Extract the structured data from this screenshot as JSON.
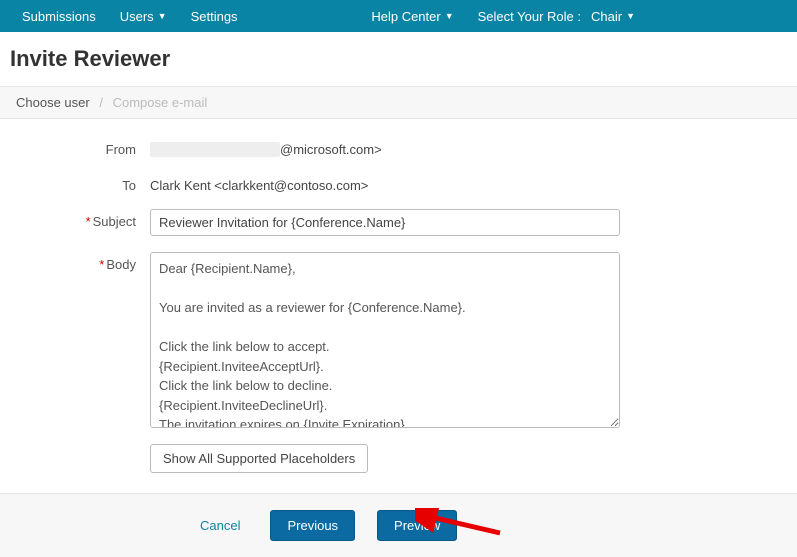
{
  "nav": {
    "submissions": "Submissions",
    "users": "Users",
    "settings": "Settings",
    "help": "Help Center",
    "role_label": "Select Your Role :",
    "role_value": "Chair"
  },
  "page": {
    "title": "Invite Reviewer"
  },
  "breadcrumb": {
    "step1": "Choose user",
    "step2": "Compose e-mail"
  },
  "form": {
    "from_label": "From",
    "from_value_suffix": "@microsoft.com>",
    "to_label": "To",
    "to_value": "Clark Kent <clarkkent@contoso.com>",
    "subject_label": "Subject",
    "subject_value": "Reviewer Invitation for {Conference.Name}",
    "body_label": "Body",
    "body_value": "Dear {Recipient.Name},\n\nYou are invited as a reviewer for {Conference.Name}.\n\nClick the link below to accept.\n{Recipient.InviteeAcceptUrl}.\nClick the link below to decline.\n{Recipient.InviteeDeclineUrl}.\nThe invitation expires on {Invite.Expiration}.\n\nPlease contact {Sender.Email} if you have questions about the invitation.",
    "placeholders_btn": "Show All Supported Placeholders"
  },
  "footer": {
    "cancel": "Cancel",
    "previous": "Previous",
    "preview": "Preview"
  }
}
